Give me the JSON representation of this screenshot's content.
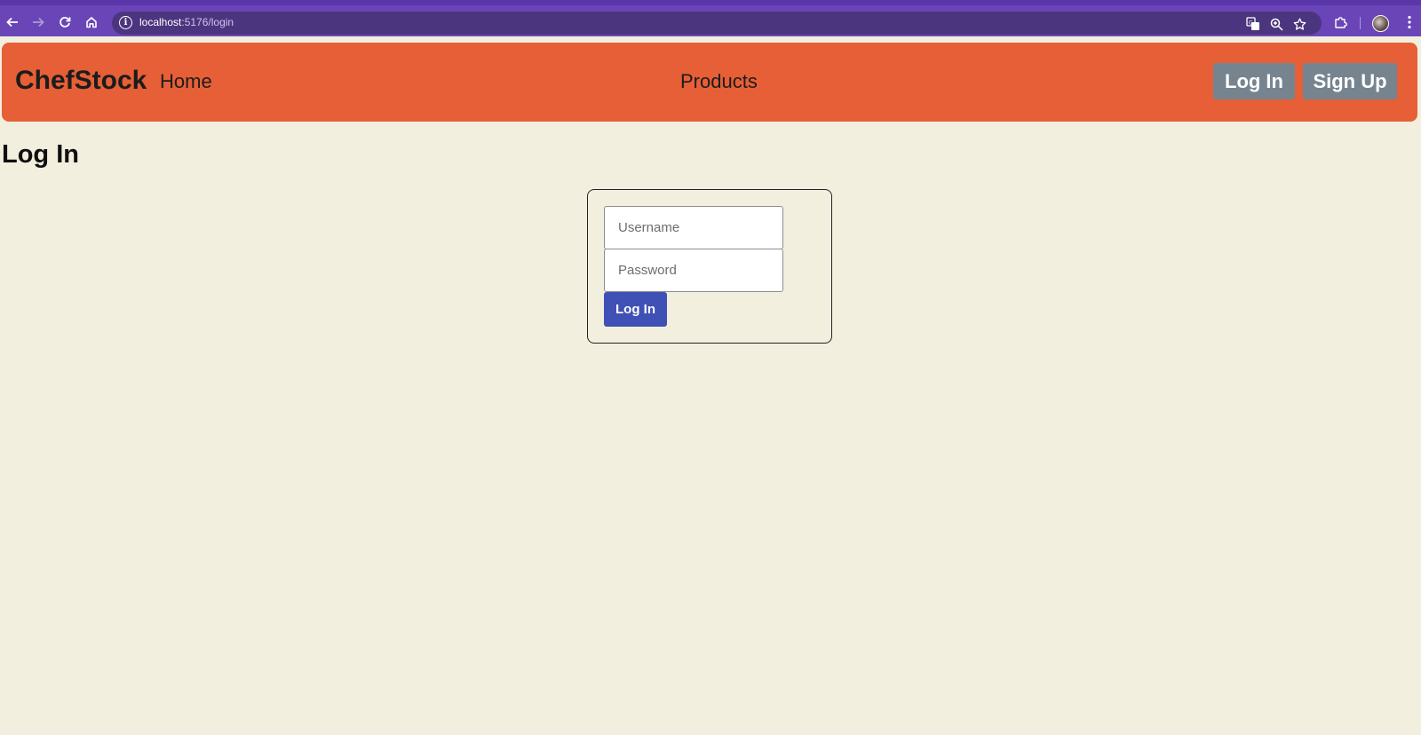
{
  "browser": {
    "url_host": "localhost",
    "url_path": ":5176/login",
    "icons": {
      "back": "back-arrow-icon",
      "forward": "forward-arrow-icon",
      "reload": "reload-icon",
      "home": "home-icon",
      "info": "info-icon",
      "translate": "translate-icon",
      "zoom": "zoom-icon",
      "bookmark": "star-icon",
      "extensions": "puzzle-icon",
      "menu": "kebab-menu-icon"
    },
    "colors": {
      "frame": "#6a45b8",
      "omnibox": "#4c357f"
    }
  },
  "navbar": {
    "brand": "ChefStock",
    "links": {
      "home": "Home",
      "products": "Products"
    },
    "buttons": {
      "login": "Log In",
      "signup": "Sign Up"
    },
    "colors": {
      "background": "#e65f36",
      "button": "#76848f"
    }
  },
  "page": {
    "title": "Log In",
    "background": "#f3efdf"
  },
  "login_form": {
    "username_placeholder": "Username",
    "password_placeholder": "Password",
    "submit_label": "Log In",
    "submit_color": "#3f51b5"
  }
}
